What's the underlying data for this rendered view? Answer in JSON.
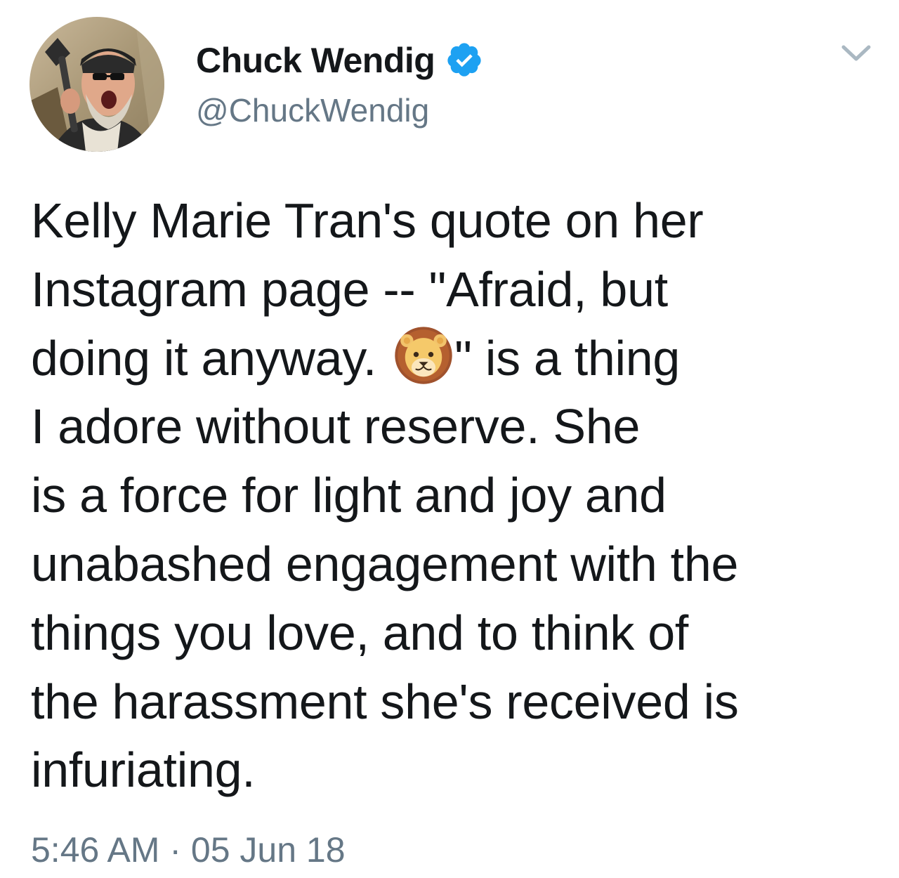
{
  "author": {
    "display_name": "Chuck Wendig",
    "handle": "@ChuckWendig",
    "verified": true,
    "avatar_icon": "profile-photo-man-with-axe"
  },
  "tweet": {
    "lines": [
      "Kelly Marie Tran's quote on her",
      "Instagram page -- \"Afraid, but",
      "doing it anyway. ",
      "\" is a thing",
      "I adore without reserve. She",
      "is a force for light and joy and",
      "unabashed engagement with the",
      "things you love, and to think of",
      "the harassment she's received is",
      "infuriating."
    ],
    "emoji_name": "lion-face-emoji",
    "time": "5:46 AM",
    "separator": "·",
    "date": "05 Jun 18"
  },
  "colors": {
    "text": "#14171a",
    "secondary": "#657786",
    "verified_blue": "#1da1f2",
    "chevron": "#aab8c2"
  }
}
